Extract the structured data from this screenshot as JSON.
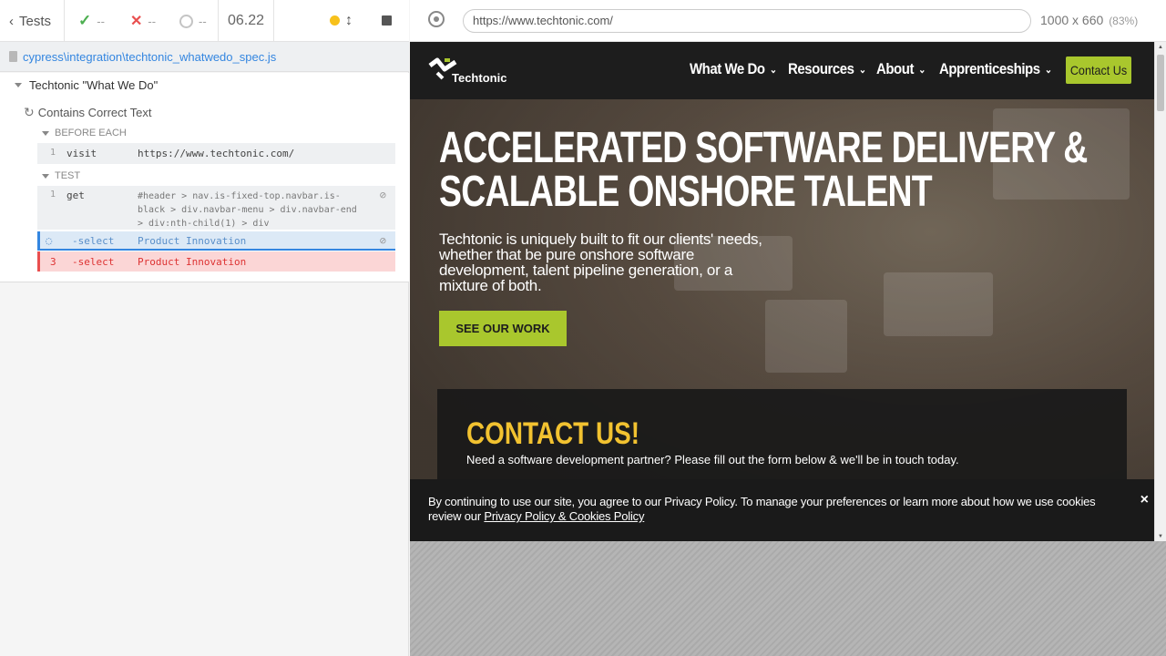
{
  "reporter": {
    "back_label": "Tests",
    "passed": "--",
    "failed": "--",
    "pending": "--",
    "duration": "06.22",
    "spec_path": "cypress\\integration\\techtonic_whatwedo_spec.js",
    "suite_title": "Techtonic \"What We Do\"",
    "test_title": "Contains Correct Text",
    "before_each_label": "BEFORE EACH",
    "test_label": "TEST",
    "commands": [
      {
        "num": "1",
        "name": "visit",
        "message": "https://www.techtonic.com/"
      },
      {
        "num": "1",
        "name": "get",
        "message": "#header > nav.is-fixed-top.navbar.is-black > div.navbar-menu > div.navbar-end > div:nth-child(1) > div"
      },
      {
        "num": "",
        "name": "-select",
        "message": "Product Innovation"
      },
      {
        "num": "3",
        "name": "-select",
        "message": "Product Innovation"
      }
    ],
    "colors": {
      "passed": "#4caf50",
      "failed": "#e94f4f",
      "running": "#f7c11b",
      "link": "#3486e0"
    }
  },
  "browser": {
    "url": "https://www.techtonic.com/",
    "viewport": "1000 x 660",
    "scale": "(83%)"
  },
  "site": {
    "logo_text": "Techtonic",
    "nav": [
      "What We Do",
      "Resources",
      "About",
      "Apprenticeships"
    ],
    "contact_button": "Contact Us",
    "hero_title_1": "ACCELERATED SOFTWARE DELIVERY &",
    "hero_title_2": "SCALABLE ONSHORE TALENT",
    "hero_subtitle": "Techtonic is uniquely built to fit our clients' needs, whether that be pure onshore software development, talent pipeline generation, or a mixture of both.",
    "cta": "SEE OUR WORK",
    "contact_title": "CONTACT US!",
    "contact_text": "Need a software development partner? Please fill out the form below & we'll be in touch today.",
    "cookie_text": "By continuing to use our site, you agree to our Privacy Policy. To manage your preferences or learn more about how we use cookies review our ",
    "cookie_link": "Privacy Policy & Cookies Policy",
    "close_symbol": "×",
    "colors": {
      "brand_green": "#a9c72d",
      "contact_yellow": "#f2c230",
      "nav_bg": "#1d1d1d"
    }
  }
}
